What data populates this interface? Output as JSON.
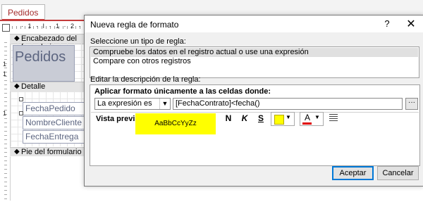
{
  "background": {
    "document_tab": "Pedidos",
    "ruler_text": "· 1 · I · 1 · 2 · 3",
    "vertical_ruler": [
      "1",
      "1",
      "1"
    ],
    "sections": {
      "header": "Encabezado del formulario",
      "detail": "Detalle",
      "footer": "Pie del formulario"
    },
    "header_label": "Pedidos",
    "fields": [
      "FechaPedido",
      "NombreCliente",
      "FechaEntrega"
    ]
  },
  "dialog": {
    "title": "Nueva regla de formato",
    "help": "?",
    "close": "✕",
    "select_type_label": "Seleccione un tipo de regla:",
    "rule_types": [
      "Compruebe los datos en el registro actual o use una expresión",
      "Compare con otros registros"
    ],
    "edit_label": "Editar la descripción de la regla:",
    "apply_label": "Aplicar formato únicamente a las celdas donde:",
    "condition": "La expresión es",
    "expression": "[FechaContrato]<fecha()",
    "expression_button": "···",
    "preview_label": "Vista previa:",
    "preview_text": "AaBbCcYyZz",
    "format_buttons": {
      "bold": "N",
      "italic": "K",
      "underline": "S"
    },
    "font_color_letter": "A",
    "colors": {
      "fill": "#ffff00",
      "font": "#e00000"
    },
    "buttons": {
      "ok": "Aceptar",
      "cancel": "Cancelar"
    }
  }
}
